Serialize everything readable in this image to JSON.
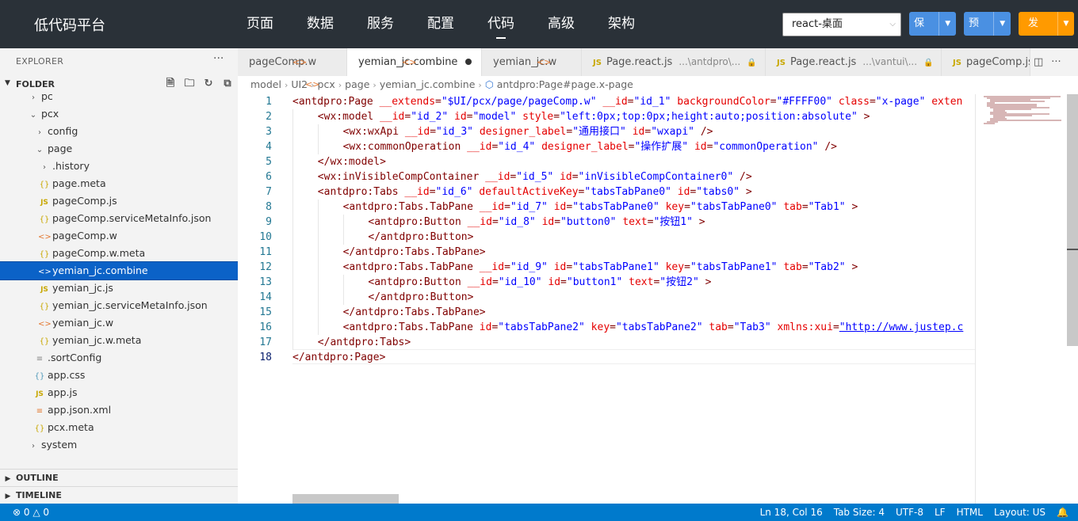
{
  "topbar": {
    "logo": "低代码平台",
    "nav": [
      "页面",
      "数据",
      "服务",
      "配置",
      "代码",
      "高级",
      "架构"
    ],
    "active_nav": "代码",
    "mode": "react-桌面",
    "save": "保存",
    "preview": "预览",
    "publish": "发布"
  },
  "sidebar": {
    "explorer": "EXPLORER",
    "folder": "FOLDER",
    "outline": "OUTLINE",
    "timeline": "TIMELINE",
    "tree": [
      {
        "label": "pc",
        "icon": "chevron-right",
        "depth": 1
      },
      {
        "label": "pcx",
        "icon": "chevron-down",
        "depth": 1
      },
      {
        "label": "config",
        "icon": "chevron-right",
        "depth": 2
      },
      {
        "label": "page",
        "icon": "chevron-down",
        "depth": 2
      },
      {
        "label": ".history",
        "icon": "chevron-right",
        "depth": 3
      },
      {
        "label": "page.meta",
        "icon": "json",
        "depth": 3
      },
      {
        "label": "pageComp.js",
        "icon": "js",
        "depth": 3
      },
      {
        "label": "pageComp.serviceMetaInfo.json",
        "icon": "json",
        "depth": 3
      },
      {
        "label": "pageComp.w",
        "icon": "code",
        "depth": 3
      },
      {
        "label": "pageComp.w.meta",
        "icon": "json",
        "depth": 3
      },
      {
        "label": "yemian_jc.combine",
        "icon": "code",
        "depth": 3,
        "selected": true
      },
      {
        "label": "yemian_jc.js",
        "icon": "js",
        "depth": 3
      },
      {
        "label": "yemian_jc.serviceMetaInfo.json",
        "icon": "json",
        "depth": 3
      },
      {
        "label": "yemian_jc.w",
        "icon": "code",
        "depth": 3
      },
      {
        "label": "yemian_jc.w.meta",
        "icon": "json",
        "depth": 3
      },
      {
        "label": ".sortConfig",
        "icon": "lines",
        "depth": 2
      },
      {
        "label": "app.css",
        "icon": "css",
        "depth": 2
      },
      {
        "label": "app.js",
        "icon": "js",
        "depth": 2
      },
      {
        "label": "app.json.xml",
        "icon": "xml",
        "depth": 2
      },
      {
        "label": "pcx.meta",
        "icon": "json",
        "depth": 2
      },
      {
        "label": "system",
        "icon": "chevron-right",
        "depth": 1
      }
    ]
  },
  "tabs": [
    {
      "label": "pageComp.w",
      "icon": "code"
    },
    {
      "label": "yemian_jc.combine",
      "icon": "code",
      "active": true,
      "dirty": true
    },
    {
      "label": "yemian_jc.w",
      "icon": "code"
    },
    {
      "label": "Page.react.js",
      "icon": "js",
      "desc": "...\\antdpro\\...",
      "locked": true
    },
    {
      "label": "Page.react.js",
      "icon": "js",
      "desc": "...\\vantui\\...",
      "locked": true
    },
    {
      "label": "pageComp.js",
      "icon": "js"
    }
  ],
  "breadcrumb": [
    "model",
    "UI2",
    "pcx",
    "page",
    "yemian_jc.combine",
    "antdpro:Page#page.x-page"
  ],
  "editor": {
    "lines": [
      {
        "n": "1",
        "indent": 0,
        "tokens": [
          [
            "t",
            "<antdpro:Page "
          ],
          [
            "a",
            "__extends"
          ],
          [
            "p",
            "="
          ],
          [
            "v",
            "\"$UI/pcx/page/pageComp.w\" "
          ],
          [
            "a",
            "__id"
          ],
          [
            "p",
            "="
          ],
          [
            "v",
            "\"id_1\" "
          ],
          [
            "a",
            "backgroundColor"
          ],
          [
            "p",
            "="
          ],
          [
            "v",
            "\"#FFFF00\" "
          ],
          [
            "a",
            "class"
          ],
          [
            "p",
            "="
          ],
          [
            "v",
            "\"x-page\" "
          ],
          [
            "a",
            "exten"
          ]
        ]
      },
      {
        "n": "2",
        "indent": 1,
        "tokens": [
          [
            "t",
            "<wx:model "
          ],
          [
            "a",
            "__id"
          ],
          [
            "p",
            "="
          ],
          [
            "v",
            "\"id_2\" "
          ],
          [
            "a",
            "id"
          ],
          [
            "p",
            "="
          ],
          [
            "v",
            "\"model\" "
          ],
          [
            "a",
            "style"
          ],
          [
            "p",
            "="
          ],
          [
            "v",
            "\"left:0px;top:0px;height:auto;position:absolute\" "
          ],
          [
            "t",
            ">"
          ]
        ]
      },
      {
        "n": "3",
        "indent": 2,
        "tokens": [
          [
            "t",
            "<wx:wxApi "
          ],
          [
            "a",
            "__id"
          ],
          [
            "p",
            "="
          ],
          [
            "v",
            "\"id_3\" "
          ],
          [
            "a",
            "designer_label"
          ],
          [
            "p",
            "="
          ],
          [
            "v",
            "\"通用接口\" "
          ],
          [
            "a",
            "id"
          ],
          [
            "p",
            "="
          ],
          [
            "v",
            "\"wxapi\" "
          ],
          [
            "t",
            "/>"
          ]
        ]
      },
      {
        "n": "4",
        "indent": 2,
        "tokens": [
          [
            "t",
            "<wx:commonOperation "
          ],
          [
            "a",
            "__id"
          ],
          [
            "p",
            "="
          ],
          [
            "v",
            "\"id_4\" "
          ],
          [
            "a",
            "designer_label"
          ],
          [
            "p",
            "="
          ],
          [
            "v",
            "\"操作扩展\" "
          ],
          [
            "a",
            "id"
          ],
          [
            "p",
            "="
          ],
          [
            "v",
            "\"commonOperation\" "
          ],
          [
            "t",
            "/>"
          ]
        ]
      },
      {
        "n": "5",
        "indent": 1,
        "tokens": [
          [
            "t",
            "</wx:model>"
          ]
        ]
      },
      {
        "n": "6",
        "indent": 1,
        "tokens": [
          [
            "t",
            "<wx:inVisibleCompContainer "
          ],
          [
            "a",
            "__id"
          ],
          [
            "p",
            "="
          ],
          [
            "v",
            "\"id_5\" "
          ],
          [
            "a",
            "id"
          ],
          [
            "p",
            "="
          ],
          [
            "v",
            "\"inVisibleCompContainer0\" "
          ],
          [
            "t",
            "/>"
          ]
        ]
      },
      {
        "n": "7",
        "indent": 1,
        "tokens": [
          [
            "t",
            "<antdpro:Tabs "
          ],
          [
            "a",
            "__id"
          ],
          [
            "p",
            "="
          ],
          [
            "v",
            "\"id_6\" "
          ],
          [
            "a",
            "defaultActiveKey"
          ],
          [
            "p",
            "="
          ],
          [
            "v",
            "\"tabsTabPane0\" "
          ],
          [
            "a",
            "id"
          ],
          [
            "p",
            "="
          ],
          [
            "v",
            "\"tabs0\" "
          ],
          [
            "t",
            ">"
          ]
        ]
      },
      {
        "n": "8",
        "indent": 2,
        "tokens": [
          [
            "t",
            "<antdpro:Tabs.TabPane "
          ],
          [
            "a",
            "__id"
          ],
          [
            "p",
            "="
          ],
          [
            "v",
            "\"id_7\" "
          ],
          [
            "a",
            "id"
          ],
          [
            "p",
            "="
          ],
          [
            "v",
            "\"tabsTabPane0\" "
          ],
          [
            "a",
            "key"
          ],
          [
            "p",
            "="
          ],
          [
            "v",
            "\"tabsTabPane0\" "
          ],
          [
            "a",
            "tab"
          ],
          [
            "p",
            "="
          ],
          [
            "v",
            "\"Tab1\" "
          ],
          [
            "t",
            ">"
          ]
        ]
      },
      {
        "n": "9",
        "indent": 3,
        "tokens": [
          [
            "t",
            "<antdpro:Button "
          ],
          [
            "a",
            "__id"
          ],
          [
            "p",
            "="
          ],
          [
            "v",
            "\"id_8\" "
          ],
          [
            "a",
            "id"
          ],
          [
            "p",
            "="
          ],
          [
            "v",
            "\"button0\" "
          ],
          [
            "a",
            "text"
          ],
          [
            "p",
            "="
          ],
          [
            "v",
            "\"按钮1\" "
          ],
          [
            "t",
            ">"
          ]
        ]
      },
      {
        "n": "10",
        "indent": 3,
        "tokens": [
          [
            "t",
            "</antdpro:Button>"
          ]
        ]
      },
      {
        "n": "11",
        "indent": 2,
        "tokens": [
          [
            "t",
            "</antdpro:Tabs.TabPane>"
          ]
        ]
      },
      {
        "n": "12",
        "indent": 2,
        "tokens": [
          [
            "t",
            "<antdpro:Tabs.TabPane "
          ],
          [
            "a",
            "__id"
          ],
          [
            "p",
            "="
          ],
          [
            "v",
            "\"id_9\" "
          ],
          [
            "a",
            "id"
          ],
          [
            "p",
            "="
          ],
          [
            "v",
            "\"tabsTabPane1\" "
          ],
          [
            "a",
            "key"
          ],
          [
            "p",
            "="
          ],
          [
            "v",
            "\"tabsTabPane1\" "
          ],
          [
            "a",
            "tab"
          ],
          [
            "p",
            "="
          ],
          [
            "v",
            "\"Tab2\" "
          ],
          [
            "t",
            ">"
          ]
        ]
      },
      {
        "n": "13",
        "indent": 3,
        "tokens": [
          [
            "t",
            "<antdpro:Button "
          ],
          [
            "a",
            "__id"
          ],
          [
            "p",
            "="
          ],
          [
            "v",
            "\"id_10\" "
          ],
          [
            "a",
            "id"
          ],
          [
            "p",
            "="
          ],
          [
            "v",
            "\"button1\" "
          ],
          [
            "a",
            "text"
          ],
          [
            "p",
            "="
          ],
          [
            "v",
            "\"按钮2\" "
          ],
          [
            "t",
            ">"
          ]
        ]
      },
      {
        "n": "14",
        "indent": 3,
        "tokens": [
          [
            "t",
            "</antdpro:Button>"
          ]
        ]
      },
      {
        "n": "15",
        "indent": 2,
        "tokens": [
          [
            "t",
            "</antdpro:Tabs.TabPane>"
          ]
        ]
      },
      {
        "n": "16",
        "indent": 2,
        "tokens": [
          [
            "t",
            "<antdpro:Tabs.TabPane "
          ],
          [
            "a",
            "id"
          ],
          [
            "p",
            "="
          ],
          [
            "v",
            "\"tabsTabPane2\" "
          ],
          [
            "a",
            "key"
          ],
          [
            "p",
            "="
          ],
          [
            "v",
            "\"tabsTabPane2\" "
          ],
          [
            "a",
            "tab"
          ],
          [
            "p",
            "="
          ],
          [
            "v",
            "\"Tab3\" "
          ],
          [
            "a",
            "xmlns:xui"
          ],
          [
            "p",
            "="
          ],
          [
            "u",
            "\"http://www.justep.c"
          ]
        ]
      },
      {
        "n": "17",
        "indent": 1,
        "tokens": [
          [
            "t",
            "</antdpro:Tabs>"
          ]
        ]
      },
      {
        "n": "18",
        "indent": 0,
        "tokens": [
          [
            "t",
            "</antdpro:Page>"
          ]
        ]
      }
    ]
  },
  "status": {
    "errors": "0",
    "warnings": "0",
    "position": "Ln 18, Col 16",
    "tab_size": "Tab Size: 4",
    "encoding": "UTF-8",
    "eol": "LF",
    "language": "HTML",
    "layout": "Layout: US"
  },
  "colors": {
    "topbar": "#2a3138",
    "accent": "#4a90e2",
    "publish": "#ff9a00",
    "statusbar": "#007acc",
    "selection": "#0b62c7"
  }
}
